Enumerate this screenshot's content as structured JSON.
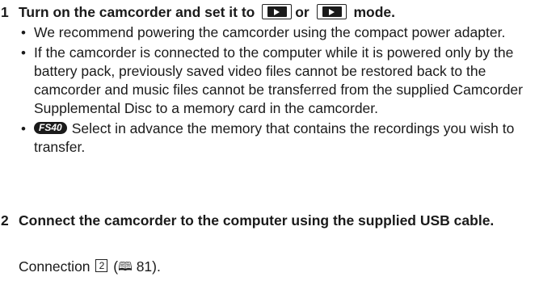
{
  "steps": [
    {
      "number": "1",
      "title_before": "Turn on the camcorder and set it to",
      "title_mid": "or",
      "title_after": "mode.",
      "icons": [
        "movie-playback-icon",
        "photo-playback-icon"
      ],
      "bullets": [
        "We recommend powering the camcorder using the compact power adapter.",
        "If the camcorder is connected to the computer while it is powered only by the battery pack, previously saved video files cannot be restored back to the camcorder and music files cannot be transferred from the supplied Camcorder Supplemental Disc to a memory card in the camcorder.",
        "Select in advance the memory that contains the recordings you wish to transfer."
      ],
      "model_badge": "FS40"
    },
    {
      "number": "2",
      "title": "Connect the camcorder to the computer using the supplied USB cable.",
      "connection_label": "Connection",
      "connection_number": "2",
      "reference_icon": "book-reference-icon",
      "reference_page": "81"
    }
  ]
}
